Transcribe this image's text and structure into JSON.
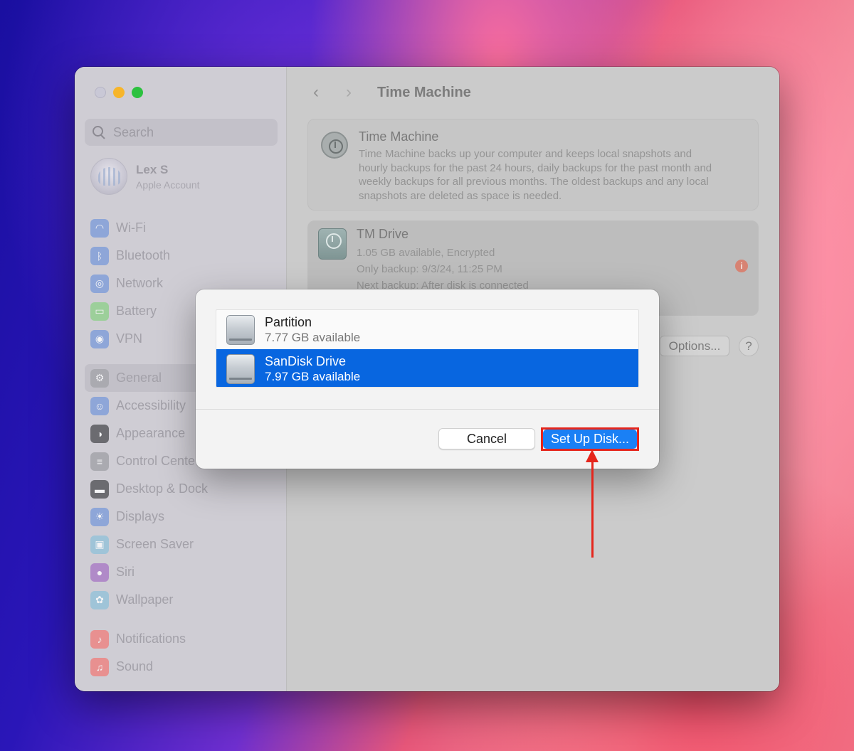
{
  "sidebar": {
    "search_placeholder": "Search",
    "account": {
      "name": "Lex S",
      "subtitle": "Apple Account"
    },
    "group1": [
      {
        "label": "Wi-Fi",
        "icon": "wifi-icon",
        "color": "#8ea6d8"
      },
      {
        "label": "Bluetooth",
        "icon": "bluetooth-icon",
        "color": "#8ea6d8"
      },
      {
        "label": "Network",
        "icon": "globe-icon",
        "color": "#8ea6d8"
      },
      {
        "label": "Battery",
        "icon": "battery-icon",
        "color": "#9ccf9a"
      },
      {
        "label": "VPN",
        "icon": "vpn-icon",
        "color": "#8ea6d8"
      }
    ],
    "group2": [
      {
        "label": "General",
        "icon": "gear-icon",
        "color": "#aaaab0",
        "active": true
      },
      {
        "label": "Accessibility",
        "icon": "accessibility-icon",
        "color": "#8ea6d8"
      },
      {
        "label": "Appearance",
        "icon": "appearance-icon",
        "color": "#6b6b70"
      },
      {
        "label": "Control Cente",
        "icon": "control-center-icon",
        "color": "#aaaab0"
      },
      {
        "label": "Desktop & Dock",
        "icon": "dock-icon",
        "color": "#6b6b70"
      },
      {
        "label": "Displays",
        "icon": "sun-icon",
        "color": "#8ea6d8"
      },
      {
        "label": "Screen Saver",
        "icon": "screen-saver-icon",
        "color": "#9fc4d8"
      },
      {
        "label": "Siri",
        "icon": "siri-icon",
        "color": "#b08ac8"
      },
      {
        "label": "Wallpaper",
        "icon": "wallpaper-icon",
        "color": "#9fc4d8"
      }
    ],
    "group3": [
      {
        "label": "Notifications",
        "icon": "bell-icon",
        "color": "#e89090"
      },
      {
        "label": "Sound",
        "icon": "speaker-icon",
        "color": "#e89090"
      }
    ]
  },
  "content": {
    "title": "Time Machine",
    "intro": {
      "title": "Time Machine",
      "lines": [
        "Time Machine backs up your computer and keeps local snapshots and",
        "hourly backups for the past 24 hours, daily backups for the past month and",
        "weekly backups for all previous months. The oldest backups and any local",
        "snapshots are deleted as space is needed."
      ]
    },
    "drive": {
      "name": "TM Drive",
      "available": "1.05 GB available, Encrypted",
      "last": "Only backup: 9/3/24, 11:25 PM",
      "next": "Next backup: After disk is connected",
      "info": "i"
    },
    "options_label": "Options...",
    "help_label": "?"
  },
  "dialog": {
    "disks": [
      {
        "name": "Partition",
        "available": "7.77 GB available",
        "selected": false
      },
      {
        "name": "SanDisk Drive",
        "available": "7.97 GB available",
        "selected": true
      }
    ],
    "cancel_label": "Cancel",
    "setup_label": "Set Up Disk..."
  },
  "colors": {
    "accent": "#1a80f5",
    "selection": "#0866e0",
    "annotation": "#e5261c"
  }
}
